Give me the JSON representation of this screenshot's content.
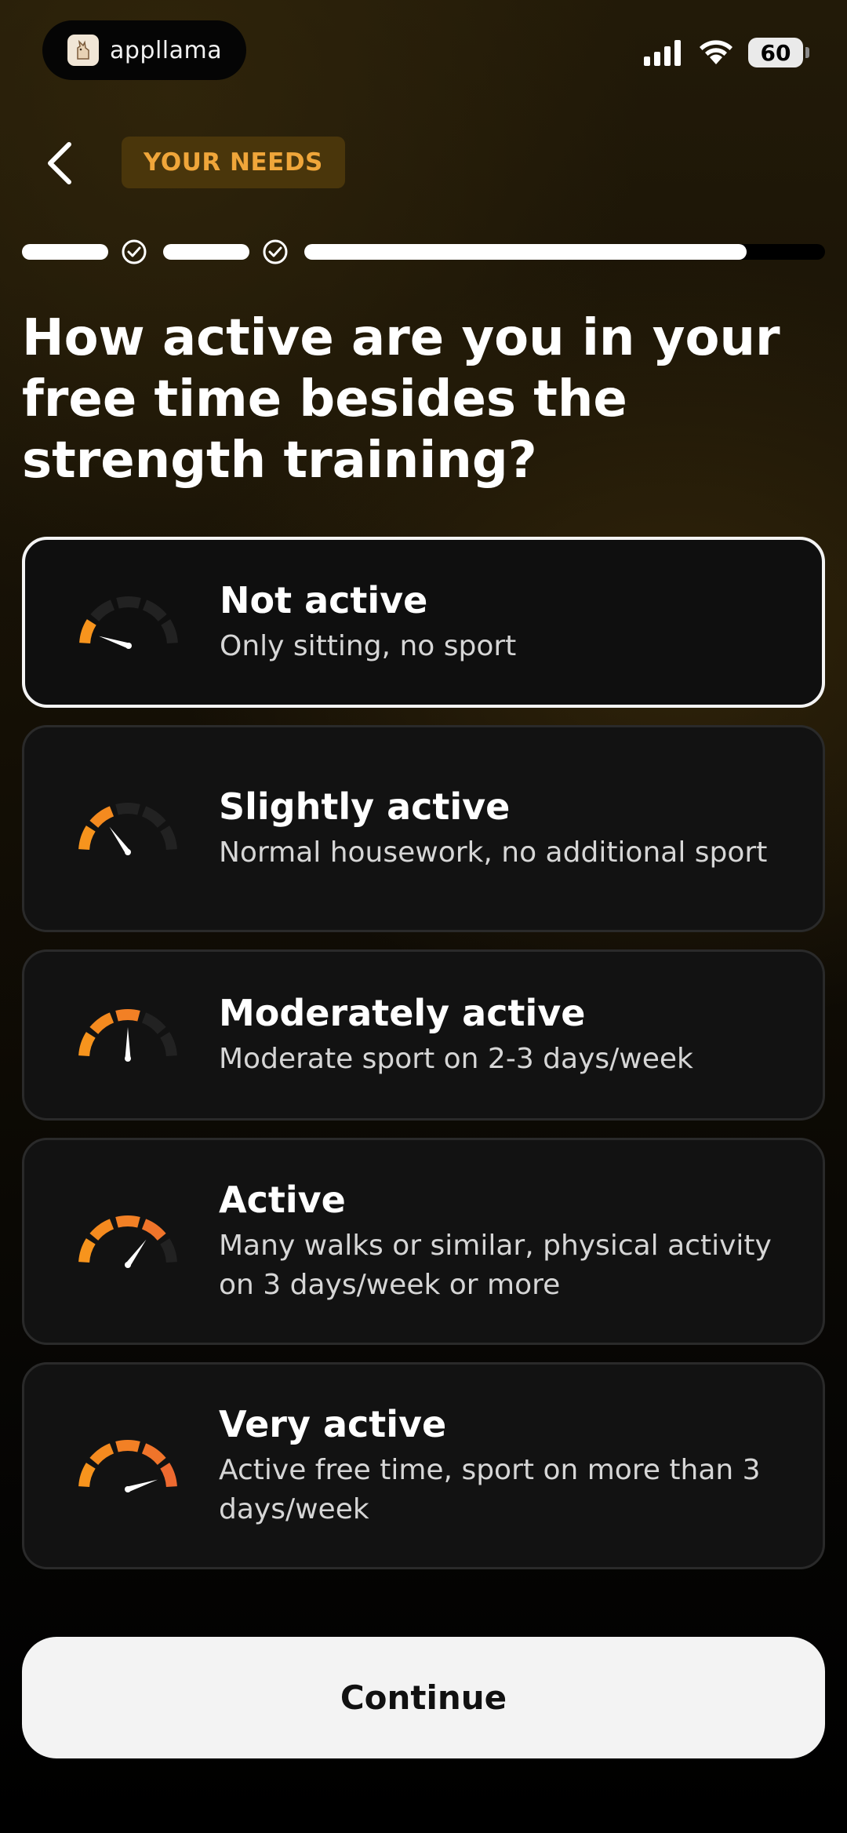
{
  "status_bar": {
    "app_name": "appllama",
    "battery": "60",
    "app_icon": "llama-icon",
    "signal_icon": "cellular-signal-icon",
    "wifi_icon": "wifi-icon"
  },
  "header": {
    "back_icon": "chevron-left-icon",
    "section_badge": "YOUR NEEDS",
    "badge_color": "#f0a63a"
  },
  "progress": {
    "completed_steps": 2,
    "current_step_fill": 0.85
  },
  "question": "How active are you in your free time besides the strength training?",
  "options": [
    {
      "title": "Not active",
      "subtitle": "Only sitting, no sport",
      "selected": true,
      "gauge_level": 1,
      "icon": "speedometer-icon"
    },
    {
      "title": "Slightly active",
      "subtitle": "Normal housework, no additional sport",
      "selected": false,
      "gauge_level": 2,
      "icon": "speedometer-icon"
    },
    {
      "title": "Moderately active",
      "subtitle": "Moderate sport on 2-3 days/week",
      "selected": false,
      "gauge_level": 3,
      "icon": "speedometer-icon"
    },
    {
      "title": "Active",
      "subtitle": "Many walks or similar, physical activity on 3 days/week or more",
      "selected": false,
      "gauge_level": 4,
      "icon": "speedometer-icon"
    },
    {
      "title": "Very active",
      "subtitle": "Active free time, sport on more than 3 days/week",
      "selected": false,
      "gauge_level": 5,
      "icon": "speedometer-icon"
    }
  ],
  "continue_label": "Continue",
  "colors": {
    "gauge_colors": [
      "#f7941d",
      "#f48a1f",
      "#f28025",
      "#f0742a",
      "#ee6a30"
    ],
    "gauge_inactive": "#222222",
    "selected_border": "#f4f4f4"
  }
}
